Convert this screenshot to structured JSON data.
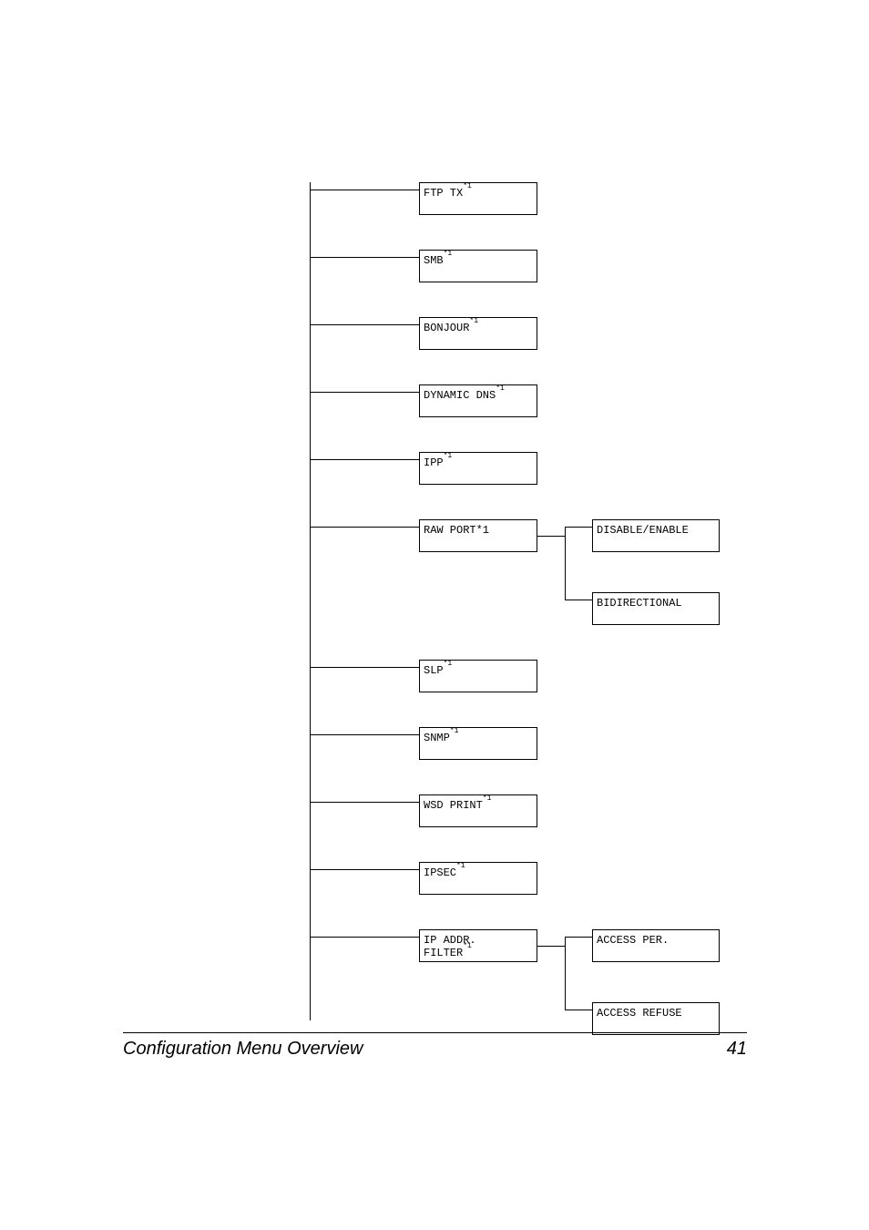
{
  "footer": {
    "title": "Configuration Menu Overview",
    "page_number": "41"
  },
  "tree": {
    "items": [
      {
        "label": "FTP TX",
        "sup": "*1"
      },
      {
        "label": "SMB",
        "sup": "*1"
      },
      {
        "label": "BONJOUR",
        "sup": "*1"
      },
      {
        "label": "DYNAMIC DNS",
        "sup": "*1"
      },
      {
        "label": "IPP",
        "sup": "*1"
      },
      {
        "label": "RAW PORT*1",
        "sup": "",
        "children": [
          "DISABLE/ENABLE",
          "BIDIRECTIONAL"
        ]
      },
      {
        "label": "SLP",
        "sup": "*1"
      },
      {
        "label": "SNMP",
        "sup": "*1"
      },
      {
        "label": "WSD PRINT",
        "sup": "*1"
      },
      {
        "label": "IPSEC",
        "sup": "*1"
      },
      {
        "label": "IP ADDR. FILTER",
        "sup": "*1",
        "children": [
          "ACCESS PER.",
          "ACCESS REFUSE"
        ]
      }
    ]
  }
}
